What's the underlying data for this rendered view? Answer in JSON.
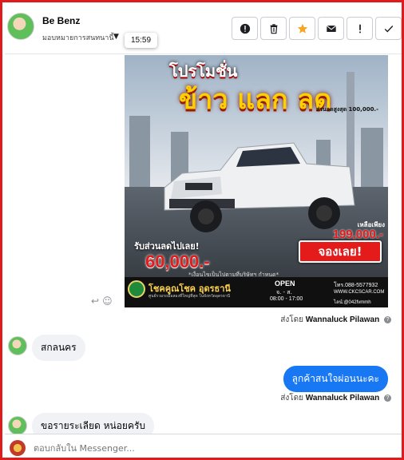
{
  "header": {
    "name": "Be Benz",
    "subtitle": "มอบหมายการสนทนานี้",
    "timestamp_tooltip": "15:59",
    "actions": [
      {
        "name": "report-button",
        "icon": "alert-circle-icon"
      },
      {
        "name": "delete-button",
        "icon": "trash-icon"
      },
      {
        "name": "star-button",
        "icon": "star-icon",
        "color": "#f5a623"
      },
      {
        "name": "mark-unread-button",
        "icon": "envelope-icon"
      },
      {
        "name": "spam-button",
        "icon": "exclamation-icon"
      },
      {
        "name": "done-button",
        "icon": "check-icon"
      }
    ]
  },
  "promo": {
    "title1": "โปรโมชั่น",
    "title2": "ข้าว แลก ลด",
    "max_discount": "ส่วนลดสูงสุด 100,000.-",
    "reduce_label": "รับส่วนลดไปเลย!",
    "discount_amount": "60,000.-",
    "remaining_label": "เหลือเพียง",
    "price": "199,000.-",
    "book_label": "จองเลย!",
    "conditions": "*เงื่อนไขเป็นไปตามที่บริษัทฯ กำหนด*",
    "brand": "โชคคูณโชค อุดรธานี",
    "brand_tagline": "ศูนย์รวมรถมือสองที่ใหญ่ที่สุด ในจังหวัดอุดรธานี",
    "open_label": "OPEN",
    "open_days": "จ. - ส.",
    "open_hours": "08:00 - 17:00",
    "phone": "โทร.088-5577932",
    "website": "WWW.CKCSCAR.COM",
    "line_id": "ไลน์:@042fvmmh"
  },
  "messages": {
    "sent_by_label": "ส่งโดย",
    "sender": "Wannaluck Pilawan",
    "incoming_1": "สกลนคร",
    "outgoing_1": "ลูกค้าสนใจผ่อนนะคะ",
    "incoming_2": "ขอรายระเลียด หน่อยครับ"
  },
  "composer": {
    "placeholder": "ตอบกลับใน Messenger..."
  },
  "colors": {
    "frame_border": "#e01b1b",
    "outgoing_bubble": "#1877f2",
    "incoming_bubble": "#f0f2f5",
    "star": "#f5a623"
  }
}
